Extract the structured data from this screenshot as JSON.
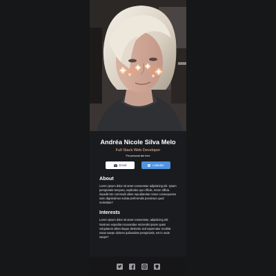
{
  "profile": {
    "name": "Andréa Nicole Silva Melo",
    "role": "Full Stack Web Developer",
    "website": "Put personal site here"
  },
  "buttons": {
    "email_label": "Email",
    "linkedin_label": "LinkedIn"
  },
  "about": {
    "title": "About",
    "text": "Lorem ipsum dolor sit amet consectetur adipisicing elit. Quam perspiciatis tempora, explicabo quo officiis, rerum officia impedit iste commodi ullam repudiandae minus consequuntur iusto dignissimos soluta perferendis possimus quod molestiae?"
  },
  "interests": {
    "title": "Interests",
    "text": "Lorem ipsum dolor sit amet consectetur, adipisicing elit. Nostrum expedita recusandae reiciendis ipsam quasi voluptatum ullam itaque distinctio sed aspernatur modi/at natus saepe dolores quibusdam perspiciatis, est in unde saepe?"
  },
  "footer_icons": [
    "twitter-icon",
    "facebook-icon",
    "instagram-icon",
    "github-icon"
  ],
  "colors": {
    "page_background": "#161719",
    "card_background": "#1a1b1e",
    "footer_background": "#161618",
    "role_accent": "#f3bf99",
    "linkedin_blue": "#5093e1",
    "icon_gray": "#9a9ca0"
  }
}
